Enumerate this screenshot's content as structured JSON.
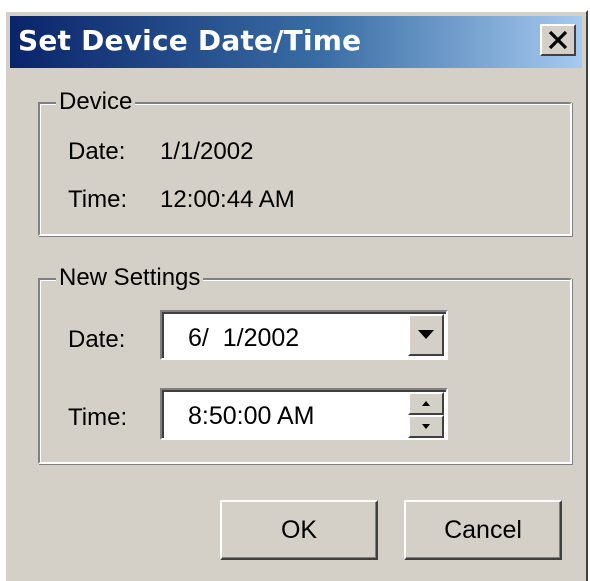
{
  "window": {
    "title": "Set Device Date/Time",
    "close_label": "✕"
  },
  "device": {
    "group_label": "Device",
    "date_label": "Date:",
    "date_value": "1/1/2002",
    "time_label": "Time:",
    "time_value": "12:00:44 AM"
  },
  "new_settings": {
    "group_label": "New Settings",
    "date_label": "Date:",
    "date_value": "6/  1/2002",
    "time_label": "Time:",
    "time_value": "8:50:00 AM"
  },
  "buttons": {
    "ok": "OK",
    "cancel": "Cancel"
  },
  "icons": {
    "close": "close-icon",
    "dropdown": "dropdown-arrow-icon",
    "spin_up": "spin-up-icon",
    "spin_down": "spin-down-icon"
  }
}
